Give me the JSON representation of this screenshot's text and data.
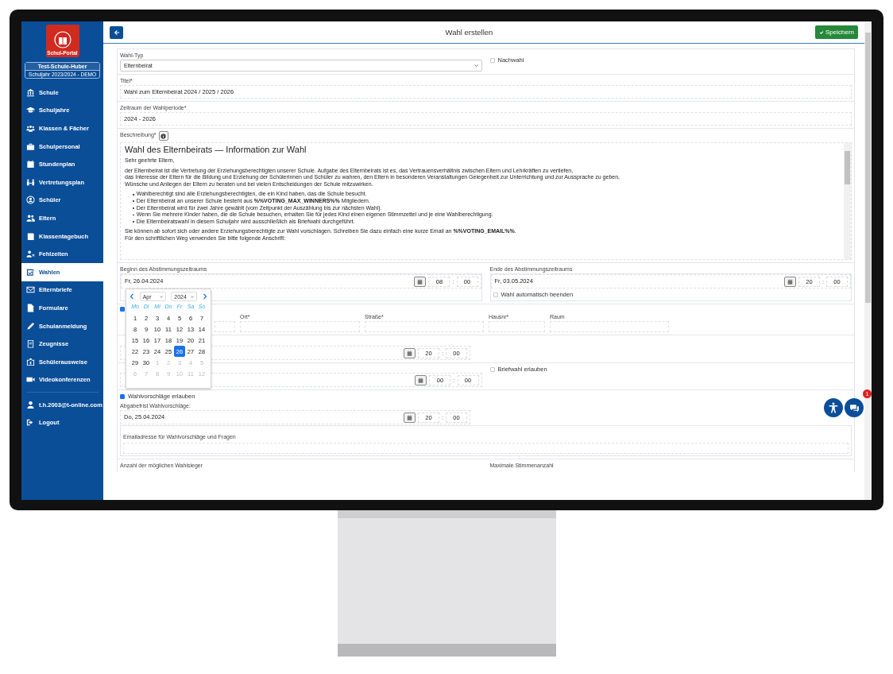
{
  "sidebar": {
    "logo_caption": "Schul-Portal",
    "school": "Test-Schule-Huber",
    "school_year": "Schuljahr 2023/2024 - DEMO",
    "items": [
      {
        "label": "Schule",
        "selected": false
      },
      {
        "label": "Schuljahre",
        "selected": false
      },
      {
        "label": "Klassen & Fächer",
        "selected": false
      },
      {
        "label": "Schulpersonal",
        "selected": false
      },
      {
        "label": "Stundenplan",
        "selected": false
      },
      {
        "label": "Vertretungsplan",
        "selected": false
      },
      {
        "label": "Schüler",
        "selected": false
      },
      {
        "label": "Eltern",
        "selected": false
      },
      {
        "label": "Klassentagebuch",
        "selected": false
      },
      {
        "label": "Fehlzeiten",
        "selected": false
      },
      {
        "label": "Wahlen",
        "selected": true
      },
      {
        "label": "Elternbriefe",
        "selected": false
      },
      {
        "label": "Formulare",
        "selected": false
      },
      {
        "label": "Schulanmeldung",
        "selected": false
      },
      {
        "label": "Zeugnisse",
        "selected": false
      },
      {
        "label": "Schülerausweise",
        "selected": false
      },
      {
        "label": "Videokonferenzen",
        "selected": false
      }
    ],
    "account": [
      {
        "label": "t.h.2003@t-online.com"
      },
      {
        "label": "Logout"
      }
    ]
  },
  "header": {
    "title": "Wahl erstellen",
    "save_button": "Speichern"
  },
  "form": {
    "wahl_typ": {
      "label": "Wahl-Typ",
      "value": "Elternbeirat"
    },
    "nachwahl": {
      "label": "Nachwahl",
      "checked": false
    },
    "titel": {
      "label": "Titel*",
      "value": "Wahl zum Elternbeirat 2024 / 2025 / 2026"
    },
    "zeitraum": {
      "label": "Zeitraum der Wahlperiode*",
      "value": "2024 - 2026"
    },
    "beschreibung": {
      "label": "Beschreibung*",
      "blocks": [
        {
          "kind": "heading",
          "lines": [
            "Wahl des Elternbeirats — Information zur Wahl"
          ]
        },
        {
          "kind": "paragraph",
          "lines": [
            "Sehr geehrte Eltern,"
          ]
        },
        {
          "kind": "paragraph",
          "lines": [
            "der Elternbeirat ist die Vertretung der Erziehungsberechtigten unserer Schule. Aufgabe des Elternbeirats ist es, das Vertrauensverhältnis zwischen Eltern und Lehrkräften zu vertiefen,",
            "das Interesse der Eltern für die Bildung und Erziehung der Schülerinnen und Schüler zu wahren, den Eltern in besonderen Veranstaltungen Gelegenheit zur Unterrichtung und zur Aussprache zu geben,",
            "Wünsche und Anliegen der Eltern zu beraten und bei vielen Entscheidungen der Schule mitzuwirken."
          ]
        },
        {
          "kind": "list",
          "lines": [
            "Wahlberechtigt sind alle Erziehungsberechtigten, die ein Kind haben, das die Schule besucht.",
            "Der Elternbeirat an unserer Schule besteht aus **%%VOTING_MAX_WINNERS%%** Mitgliedern.",
            "Der Elternbeirat wird für zwei Jahre gewählt (vom Zeitpunkt der Auszählung bis zur nächsten Wahl).",
            "Wenn Sie mehrere Kinder haben, die die Schule besuchen, erhalten Sie für jedes Kind einen eigenen Stimmzettel und je eine Wahlberechtigung.",
            "Die Elternbeiratswahl in diesem Schuljahr wird ausschließlich als Briefwahl durchgeführt."
          ]
        },
        {
          "kind": "paragraph",
          "lines": [
            "Sie können ab sofort sich oder andere Erziehungsberechtigte zur Wahl vorschlagen. Schreiben Sie dazu einfach eine kurze Email an **%%VOTING_EMAIL%%**.",
            "Für den schriftlichen Weg verwenden Sie bitte folgende Anschrift:"
          ]
        }
      ]
    },
    "beginn": {
      "label": "Beginn des Abstimmungszeitraums",
      "date": "Fr, 26.04.2024",
      "hour": "08",
      "separator": ":",
      "minute": "00"
    },
    "ende": {
      "label": "Ende des Abstimmungszeitraums",
      "date": "Fr, 03.05.2024",
      "hour": "20",
      "separator": ":",
      "minute": "00",
      "auto_end": {
        "label": "Wahl automatisch beenden",
        "checked": false
      }
    },
    "address_checkbox": {
      "checked": true
    },
    "address": [
      {
        "label": "Ort*"
      },
      {
        "label": "Straße*"
      },
      {
        "label": "Hausnr*"
      },
      {
        "label": "Raum"
      }
    ],
    "date_3": {
      "hour": "20",
      "separator": ":",
      "minute": "00"
    },
    "briefwahl": {
      "label": "Briefwahl erlauben",
      "checked": false
    },
    "date_4": {
      "hour": "00",
      "separator": ":",
      "minute": "00"
    },
    "wahlvorschlaege": {
      "label": "Wahlvorschläge erlauben",
      "checked": true
    },
    "abgabefrist": {
      "label": "Abgabefrist Wahlvorschläge:",
      "date": "Do, 25.04.2024",
      "hour": "20",
      "separator": ":",
      "minute": "00"
    },
    "email": {
      "label": "Emailadresse für Wahlvorschläge und Fragen"
    },
    "anzahl": {
      "label": "Anzahl der möglichen Wahlsieger"
    },
    "max_stimmen": {
      "label": "Maximale Stimmenanzahl"
    }
  },
  "datepicker": {
    "month": "Apr",
    "year": "2024",
    "weekdays": [
      "Mo",
      "Di",
      "Mi",
      "Do",
      "Fr",
      "Sa",
      "So"
    ],
    "weeks": [
      [
        {
          "day": "1",
          "outside": false,
          "selected": false
        },
        {
          "day": "2",
          "outside": false,
          "selected": false
        },
        {
          "day": "3",
          "outside": false,
          "selected": false
        },
        {
          "day": "4",
          "outside": false,
          "selected": false
        },
        {
          "day": "5",
          "outside": false,
          "selected": false
        },
        {
          "day": "6",
          "outside": false,
          "selected": false
        },
        {
          "day": "7",
          "outside": false,
          "selected": false
        }
      ],
      [
        {
          "day": "8",
          "outside": false,
          "selected": false
        },
        {
          "day": "9",
          "outside": false,
          "selected": false
        },
        {
          "day": "10",
          "outside": false,
          "selected": false
        },
        {
          "day": "11",
          "outside": false,
          "selected": false
        },
        {
          "day": "12",
          "outside": false,
          "selected": false
        },
        {
          "day": "13",
          "outside": false,
          "selected": false
        },
        {
          "day": "14",
          "outside": false,
          "selected": false
        }
      ],
      [
        {
          "day": "15",
          "outside": false,
          "selected": false
        },
        {
          "day": "16",
          "outside": false,
          "selected": false
        },
        {
          "day": "17",
          "outside": false,
          "selected": false
        },
        {
          "day": "18",
          "outside": false,
          "selected": false
        },
        {
          "day": "19",
          "outside": false,
          "selected": false
        },
        {
          "day": "20",
          "outside": false,
          "selected": false
        },
        {
          "day": "21",
          "outside": false,
          "selected": false
        }
      ],
      [
        {
          "day": "22",
          "outside": false,
          "selected": false
        },
        {
          "day": "23",
          "outside": false,
          "selected": false
        },
        {
          "day": "24",
          "outside": false,
          "selected": false
        },
        {
          "day": "25",
          "outside": false,
          "selected": false
        },
        {
          "day": "26",
          "outside": false,
          "selected": true
        },
        {
          "day": "27",
          "outside": false,
          "selected": false
        },
        {
          "day": "28",
          "outside": false,
          "selected": false
        }
      ],
      [
        {
          "day": "29",
          "outside": false,
          "selected": false
        },
        {
          "day": "30",
          "outside": false,
          "selected": false
        },
        {
          "day": "1",
          "outside": true,
          "selected": false
        },
        {
          "day": "2",
          "outside": true,
          "selected": false
        },
        {
          "day": "3",
          "outside": true,
          "selected": false
        },
        {
          "day": "4",
          "outside": true,
          "selected": false
        },
        {
          "day": "5",
          "outside": true,
          "selected": false
        }
      ],
      [
        {
          "day": "6",
          "outside": true,
          "selected": false
        },
        {
          "day": "7",
          "outside": true,
          "selected": false
        },
        {
          "day": "8",
          "outside": true,
          "selected": false
        },
        {
          "day": "9",
          "outside": true,
          "selected": false
        },
        {
          "day": "10",
          "outside": true,
          "selected": false
        },
        {
          "day": "11",
          "outside": true,
          "selected": false
        },
        {
          "day": "12",
          "outside": true,
          "selected": false
        }
      ]
    ]
  },
  "chat_badge": "1"
}
